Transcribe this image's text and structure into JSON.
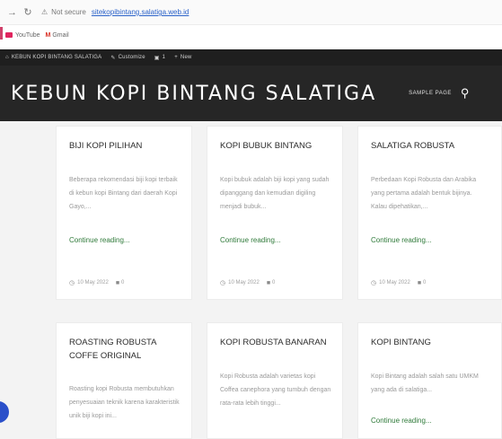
{
  "browser": {
    "not_secure": "Not secure",
    "url": "sitekopibintang.salatiga.web.id"
  },
  "bookmarks": [
    {
      "label": "YouTube"
    },
    {
      "label": "Gmail"
    }
  ],
  "admin_bar": {
    "site": "KEBUN KOPI BINTANG SALATIGA",
    "customize": "Customize",
    "updates": "1",
    "new": "New"
  },
  "header": {
    "title": "KEBUN KOPI BINTANG SALATIGA",
    "nav_item": "SAMPLE PAGE"
  },
  "cards": [
    {
      "title": "BIJI KOPI PILIHAN",
      "excerpt": "Beberapa rekomendasi biji kopi terbaik di kebun kopi Bintang dari daerah Kopi Gayo,...",
      "link": "Continue reading...",
      "date": "10 May 2022",
      "comments": "0"
    },
    {
      "title": "KOPI BUBUK BINTANG",
      "excerpt": "Kopi bubuk adalah biji kopi yang sudah dipanggang dan kemudian digiling menjadi bubuk...",
      "link": "Continue reading...",
      "date": "10 May 2022",
      "comments": "0"
    },
    {
      "title": "SALATIGA ROBUSTA",
      "excerpt": "Perbedaan Kopi Robusta dan Arabika yang pertama adalah bentuk bijinya. Kalau dipehatikan,...",
      "link": "Continue reading...",
      "date": "10 May 2022",
      "comments": "0"
    },
    {
      "title": "ROASTING ROBUSTA COFFE ORIGINAL",
      "excerpt": "Roasting kopi Robusta membutuhkan penyesuaian teknik karena karakteristik unik biji kopi ini...",
      "link": "",
      "date": "",
      "comments": ""
    },
    {
      "title": "KOPI ROBUSTA BANARAN",
      "excerpt": "Kopi Robusta adalah varietas kopi Coffea canephora yang tumbuh dengan rata-rata lebih tinggi...",
      "link": "",
      "date": "",
      "comments": ""
    },
    {
      "title": "KOPI BINTANG",
      "excerpt": "Kopi Bintang adalah salah satu UMKM yang ada di salatiga...",
      "link": "Continue reading...",
      "date": "",
      "comments": ""
    }
  ]
}
